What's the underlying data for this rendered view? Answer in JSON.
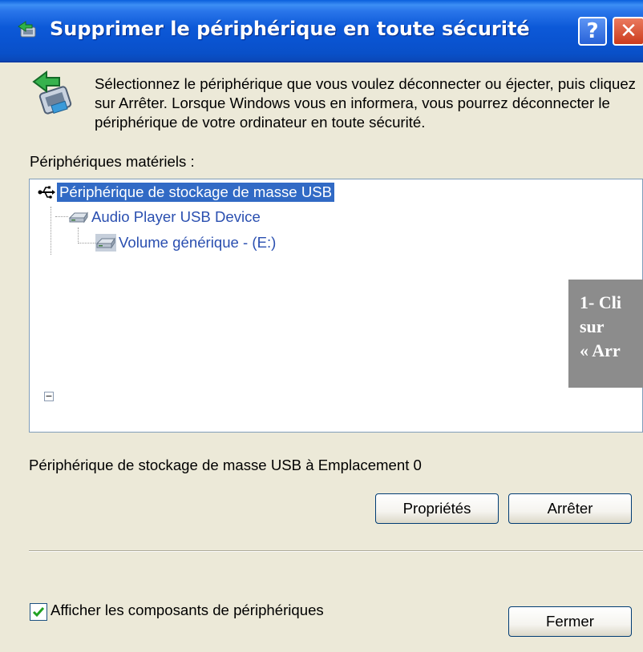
{
  "window": {
    "title": "Supprimer le périphérique en toute sécurité",
    "title_icon": "safely-remove-hardware-icon",
    "help_label": "?",
    "close_label": "✕"
  },
  "intro": {
    "icon": "safely-remove-hardware-icon",
    "text": "Sélectionnez le périphérique que vous voulez déconnecter ou éjecter, puis cliquez sur Arrêter. Lorsque Windows vous en informera, vous pourrez déconnecter le périphérique de votre ordinateur en toute sécurité."
  },
  "devices": {
    "label": "Périphériques matériels :",
    "items": [
      {
        "label": "Périphérique de stockage de masse USB",
        "icon": "usb-icon",
        "selected": true
      },
      {
        "label": "Audio Player USB Device",
        "icon": "disk-drive-icon",
        "selected": false
      },
      {
        "label": "Volume générique - (E:)",
        "icon": "volume-icon",
        "selected": false
      }
    ],
    "expander": "−"
  },
  "callout": {
    "line1": "1- Cli",
    "line2": "sur",
    "line3": "« Arr"
  },
  "status": "Périphérique de stockage de masse USB à Emplacement 0",
  "buttons": {
    "properties": "Propriétés",
    "stop": "Arrêter",
    "close": "Fermer"
  },
  "show_components": {
    "label": "Afficher les composants de périphériques",
    "checked": true
  },
  "colors": {
    "titlebar": "#0a53d0",
    "selection": "#316ac5",
    "tree_text": "#2a4fb0",
    "callout_bg": "#8c8c8c"
  }
}
